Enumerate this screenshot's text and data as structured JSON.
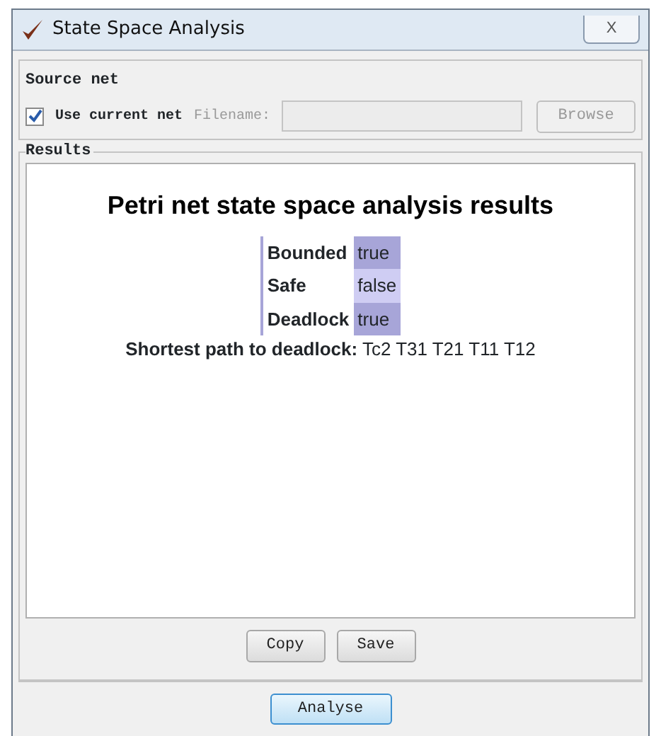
{
  "window": {
    "title": "State Space Analysis",
    "close_label": "X"
  },
  "source_net": {
    "legend": "Source net",
    "use_current": {
      "label": "Use current net",
      "checked": true
    },
    "filename": {
      "label": "Filename:",
      "disabled": true
    },
    "browse": {
      "label": "Browse",
      "disabled": true
    }
  },
  "results": {
    "legend": "Results",
    "heading": "Petri net state space analysis results",
    "rows": [
      {
        "label": "Bounded",
        "value": "true",
        "color": "#a7a5d8"
      },
      {
        "label": "Safe",
        "value": "false",
        "color": "#cfcdf3"
      },
      {
        "label": "Deadlock",
        "value": "true",
        "color": "#a7a5d8"
      }
    ],
    "path_label": "Shortest path to deadlock:",
    "path_value": "Tc2 T31 T21 T11 T12"
  },
  "buttons": [
    {
      "label": "Copy"
    },
    {
      "label": "Save"
    }
  ],
  "analyse": {
    "label": "Analyse",
    "default": true
  }
}
